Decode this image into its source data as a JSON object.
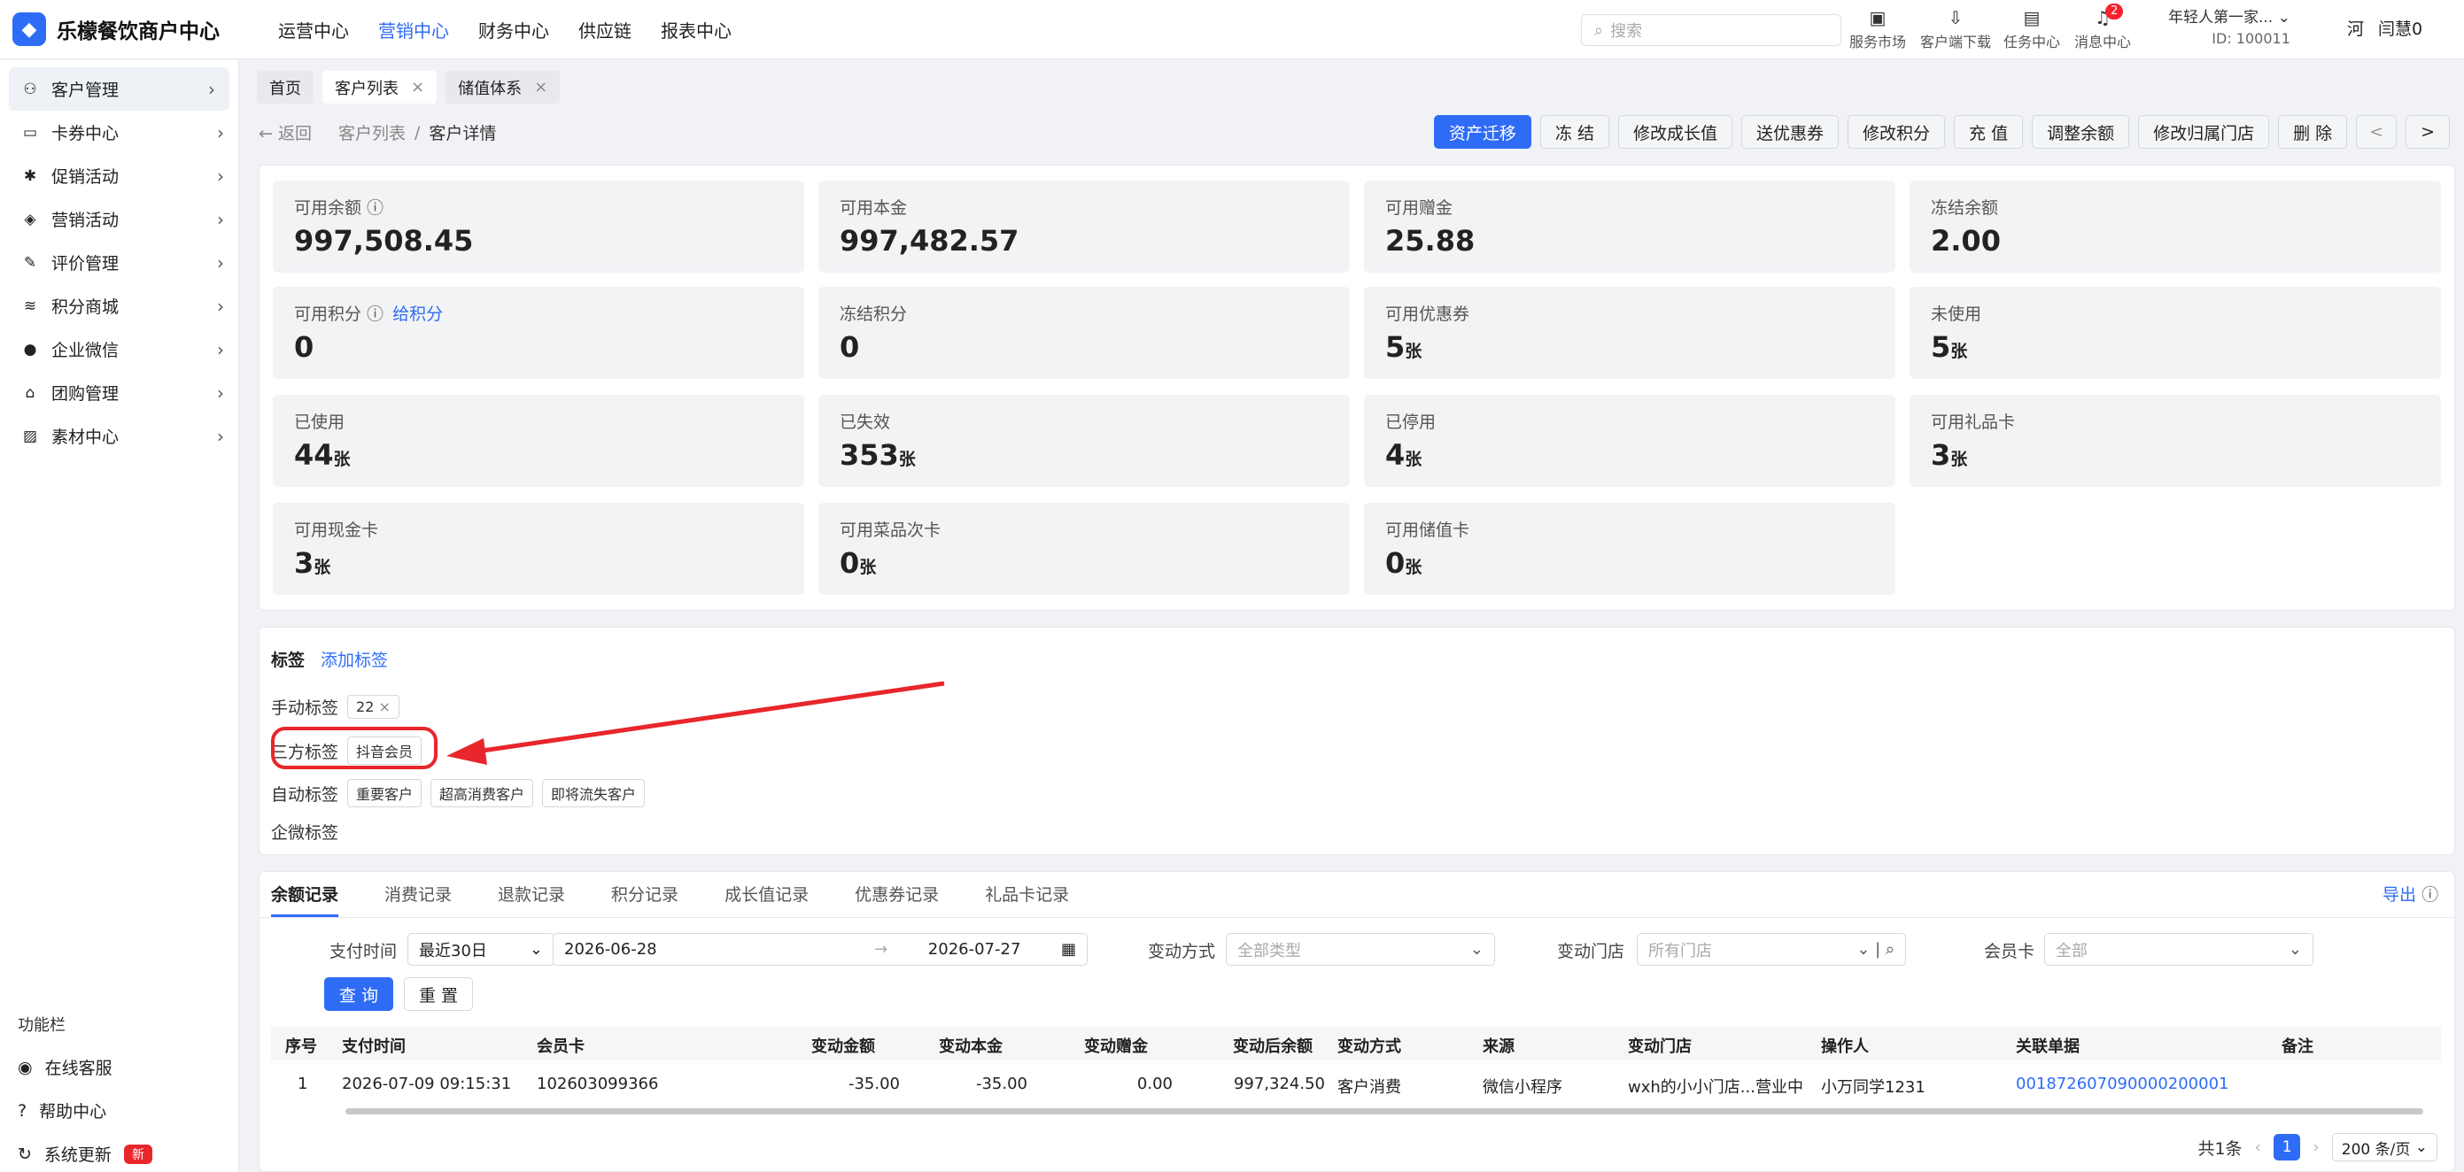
{
  "brand": {
    "name": "乐檬餐饮商户中心"
  },
  "topnav": [
    "运营中心",
    "营销中心",
    "财务中心",
    "供应链",
    "报表中心"
  ],
  "search": {
    "placeholder": "搜索"
  },
  "tools": [
    {
      "label": "服务市场",
      "icon": "store-icon"
    },
    {
      "label": "客户端下载",
      "icon": "download-icon"
    },
    {
      "label": "任务中心",
      "icon": "task-icon"
    },
    {
      "label": "消息中心",
      "icon": "bell-icon",
      "badge": "2"
    }
  ],
  "shop": {
    "name": "年轻人第一家...",
    "id": "ID: 100011"
  },
  "user": {
    "logo_text": "河",
    "name": "闫慧0"
  },
  "sidebar": {
    "items": [
      {
        "label": "客户管理"
      },
      {
        "label": "卡券中心"
      },
      {
        "label": "促销活动"
      },
      {
        "label": "营销活动"
      },
      {
        "label": "评价管理"
      },
      {
        "label": "积分商城"
      },
      {
        "label": "企业微信"
      },
      {
        "label": "团购管理"
      },
      {
        "label": "素材中心"
      }
    ],
    "section_label": "功能栏",
    "bottom": [
      {
        "label": "在线客服"
      },
      {
        "label": "帮助中心"
      },
      {
        "label": "系统更新",
        "badge": "新"
      }
    ]
  },
  "tabs": [
    {
      "label": "首页"
    },
    {
      "label": "客户列表"
    },
    {
      "label": "储值体系"
    }
  ],
  "breadcrumb": {
    "back": "返回",
    "parent": "客户列表",
    "sep": "/",
    "current": "客户详情"
  },
  "actions": [
    "资产迁移",
    "冻 结",
    "修改成长值",
    "送优惠券",
    "修改积分",
    "充 值",
    "调整余额",
    "修改归属门店",
    "删 除"
  ],
  "nav": {
    "prev": "<",
    "next": ">"
  },
  "stats": [
    {
      "label": "可用余额",
      "value": "997,508.45"
    },
    {
      "label": "可用本金",
      "value": "997,482.57"
    },
    {
      "label": "可用赠金",
      "value": "25.88"
    },
    {
      "label": "冻结余额",
      "value": "2.00"
    },
    {
      "label": "可用积分",
      "value": "0",
      "link": "给积分"
    },
    {
      "label": "冻结积分",
      "value": "0"
    },
    {
      "label": "可用优惠券",
      "value": "5",
      "unit": "张"
    },
    {
      "label": "未使用",
      "value": "5",
      "unit": "张"
    },
    {
      "label": "已使用",
      "value": "44",
      "unit": "张"
    },
    {
      "label": "已失效",
      "value": "353",
      "unit": "张"
    },
    {
      "label": "已停用",
      "value": "4",
      "unit": "张"
    },
    {
      "label": "可用礼品卡",
      "value": "3",
      "unit": "张"
    },
    {
      "label": "可用现金卡",
      "value": "3",
      "unit": "张"
    },
    {
      "label": "可用菜品次卡",
      "value": "0",
      "unit": "张"
    },
    {
      "label": "可用储值卡",
      "value": "0",
      "unit": "张"
    }
  ],
  "tags": {
    "title": "标签",
    "add": "添加标签",
    "manual_label": "手动标签",
    "manual": [
      "22"
    ],
    "third_label": "三方标签",
    "third": [
      "抖音会员"
    ],
    "auto_label": "自动标签",
    "auto": [
      "重要客户",
      "超高消费客户",
      "即将流失客户"
    ],
    "wecom_label": "企微标签"
  },
  "record_tabs": [
    "余额记录",
    "消费记录",
    "退款记录",
    "积分记录",
    "成长值记录",
    "优惠券记录",
    "礼品卡记录"
  ],
  "export": "导出",
  "filters": {
    "pay_time_label": "支付时间",
    "range": "最近30日",
    "start": "2026-06-28",
    "end": "2026-07-27",
    "change_type_label": "变动方式",
    "change_type_ph": "全部类型",
    "store_label": "变动门店",
    "store_ph": "所有门店",
    "card_label": "会员卡",
    "card_ph": "全部",
    "query": "查 询",
    "reset": "重 置"
  },
  "table": {
    "headers": [
      "序号",
      "支付时间",
      "会员卡",
      "变动金额",
      "变动本金",
      "变动赠金",
      "变动后余额",
      "变动方式",
      "来源",
      "变动门店",
      "操作人",
      "关联单据",
      "备注"
    ],
    "rows": [
      [
        "1",
        "2026-07-09 09:15:31",
        "102603099366",
        "-35.00",
        "-35.00",
        "0.00",
        "997,324.50",
        "客户消费",
        "微信小程序",
        "wxh的小小门店...营业中",
        "小万同学1231",
        "001872607090000200001",
        ""
      ]
    ]
  },
  "pager": {
    "total": "共1条",
    "page": "1",
    "size": "200 条/页"
  },
  "colors": {
    "accent": "#2f6cf6",
    "annotation": "#e8262b"
  }
}
